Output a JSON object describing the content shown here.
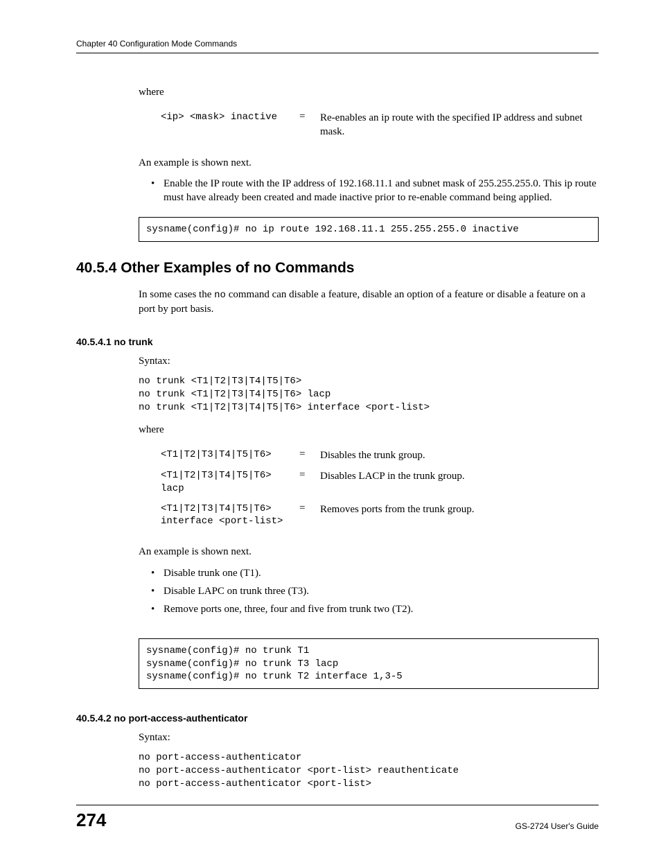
{
  "header": {
    "chapter_title": "Chapter 40 Configuration Mode Commands"
  },
  "section_where_1": {
    "label": "where",
    "params": [
      {
        "code": "<ip> <mask> inactive",
        "eq": "=",
        "desc": "Re-enables an ip route with the specified IP address and subnet mask."
      }
    ]
  },
  "para_example_1": "An example is shown next.",
  "bullets_1": [
    "Enable the IP route with the IP address of 192.168.11.1 and subnet mask of 255.255.255.0. This ip route must have already been created and made inactive prior to re-enable command being applied."
  ],
  "codebox_1": "sysname(config)# no ip route 192.168.11.1 255.255.255.0 inactive",
  "heading_40_5_4": "40.5.4  Other Examples of no Commands",
  "para_40_5_4_pre": "In some cases the ",
  "para_40_5_4_mono": "no",
  "para_40_5_4_post": " command can disable a feature, disable an option of a feature or disable a feature on a port by port basis.",
  "heading_40_5_4_1": "40.5.4.1  no trunk",
  "syntax_label": "Syntax:",
  "syntax_40_5_4_1": "no trunk <T1|T2|T3|T4|T5|T6>\nno trunk <T1|T2|T3|T4|T5|T6> lacp\nno trunk <T1|T2|T3|T4|T5|T6> interface <port-list>",
  "section_where_2": {
    "label": "where",
    "params": [
      {
        "code": "<T1|T2|T3|T4|T5|T6>",
        "eq": "=",
        "desc": "Disables the trunk group."
      },
      {
        "code": "<T1|T2|T3|T4|T5|T6> lacp",
        "eq": "=",
        "desc": "Disables LACP in the trunk group."
      },
      {
        "code": "<T1|T2|T3|T4|T5|T6> interface <port-list>",
        "eq": "=",
        "desc": "Removes ports from the trunk group."
      }
    ]
  },
  "para_example_2": "An example is shown next.",
  "bullets_2": [
    "Disable trunk one (T1).",
    "Disable LAPC on trunk three (T3).",
    "Remove ports one, three, four and five from trunk two (T2)."
  ],
  "codebox_2": "sysname(config)# no trunk T1\nsysname(config)# no trunk T3 lacp\nsysname(config)# no trunk T2 interface 1,3-5",
  "heading_40_5_4_2": "40.5.4.2  no port-access-authenticator",
  "syntax_40_5_4_2": "no port-access-authenticator\nno port-access-authenticator <port-list> reauthenticate\nno port-access-authenticator <port-list>",
  "footer": {
    "page": "274",
    "guide": "GS-2724 User's Guide"
  }
}
